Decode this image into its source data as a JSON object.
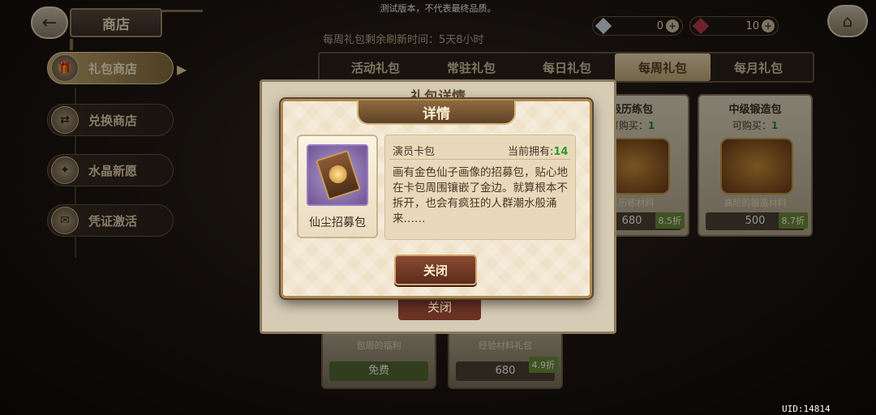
{
  "disclaimer": "测试版本，不代表最终品质。",
  "header": {
    "back_icon": "back-arrow-icon",
    "title": "商店",
    "home_icon": "home-icon"
  },
  "currencies": [
    {
      "icon": "diamond-icon",
      "value": "0",
      "color": "#dfe6f5"
    },
    {
      "icon": "red-crystal-icon",
      "value": "10",
      "color": "#c0394f"
    }
  ],
  "refresh_text": "每周礼包剩余刷新时间：5天8小时",
  "tabs": [
    {
      "label": "活动礼包",
      "active": false
    },
    {
      "label": "常驻礼包",
      "active": false
    },
    {
      "label": "每日礼包",
      "active": false
    },
    {
      "label": "每周礼包",
      "active": true
    },
    {
      "label": "每月礼包",
      "active": false
    }
  ],
  "sidebar": [
    {
      "label": "礼包商店",
      "icon": "gift-icon",
      "active": true
    },
    {
      "label": "兑换商店",
      "icon": "exchange-icon",
      "active": false
    },
    {
      "label": "水晶新愿",
      "icon": "crystal-icon",
      "active": false
    },
    {
      "label": "凭证激活",
      "icon": "voucher-icon",
      "active": false
    }
  ],
  "bg_cards": [
    {
      "title": "级历练包",
      "buy_label": "可购买：",
      "buy_count": "1",
      "caption": "…历练材料",
      "price": "680",
      "discount": "8.5折"
    },
    {
      "title": "中级锻造包",
      "buy_label": "可购买：",
      "buy_count": "1",
      "caption": "高阶的锻造材料",
      "price": "500",
      "discount": "8.7折"
    }
  ],
  "bottom_cards": [
    {
      "caption": "包周的福利",
      "price": "免费",
      "discount": ""
    },
    {
      "caption": "经验材料礼包",
      "price": "680",
      "discount": "4.9折"
    }
  ],
  "pack_panel": {
    "title": "礼包详情",
    "close_label": "关闭"
  },
  "dialog": {
    "title": "详情",
    "item_name": "仙尘招募包",
    "card_name": "演员卡包",
    "owned_label": "当前拥有:",
    "owned_value": "14",
    "description": "画有金色仙子画像的招募包，贴心地在卡包周围镶嵌了金边。就算根本不拆开，也会有疯狂的人群潮水般涌来……",
    "close_label": "关闭"
  },
  "uid": "UID:14814"
}
